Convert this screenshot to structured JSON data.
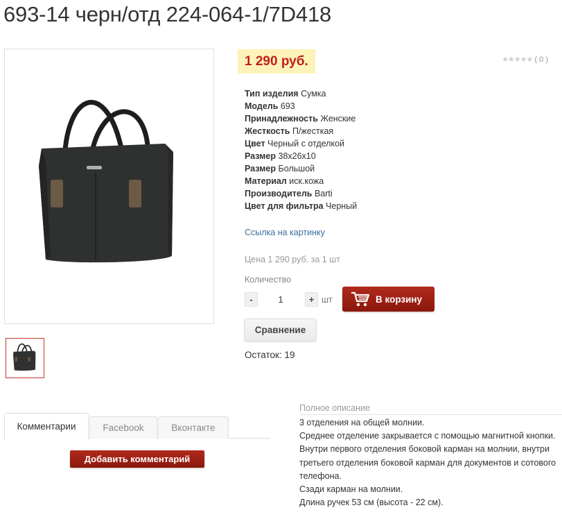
{
  "product": {
    "title": "693-14 черн/отд 224-064-1/7D418",
    "price": "1 290 руб.",
    "rating": {
      "stars": "★★★★★",
      "count": "( 0 )"
    },
    "properties": [
      {
        "key": "Тип изделия",
        "value": "Сумка"
      },
      {
        "key": "Модель",
        "value": "693"
      },
      {
        "key": "Принадлежность",
        "value": "Женские"
      },
      {
        "key": "Жесткость",
        "value": "П/жесткая"
      },
      {
        "key": "Цвет",
        "value": "Черный с отделкой"
      },
      {
        "key": "Размер",
        "value": "38х26х10"
      },
      {
        "key": "Размер",
        "value": "Большой"
      },
      {
        "key": "Материал",
        "value": "иск.кожа"
      },
      {
        "key": "Производитель",
        "value": "Barti"
      },
      {
        "key": "Цвет для фильтра",
        "value": "Черный"
      }
    ],
    "image_link": "Ссылка на картинку",
    "price_per_unit": "Цена 1 290 руб. за 1 шт",
    "quantity": {
      "label": "Количество",
      "minus": "-",
      "value": "1",
      "plus": "+",
      "unit": "шт"
    },
    "cart_button": "В корзину",
    "compare_button": "Сравнение",
    "stock": "Остаток: 19"
  },
  "tabs": [
    {
      "label": "Комментарии",
      "active": true
    },
    {
      "label": "Facebook",
      "active": false
    },
    {
      "label": "Вконтакте",
      "active": false
    }
  ],
  "add_comment_button": "Добавить комментарий",
  "description": {
    "heading": "Полное описание",
    "lines": [
      "3 отделения на общей молнии.",
      "Среднее отделение закрывается с помощью магнитной кнопки.",
      "Внутри первого отделения боковой карман на молнии, внутри третьего отделения боковой карман для документов и сотового телефона.",
      "Сзади карман на молнии.",
      "Длина ручек 53 см (высота - 22 см)."
    ]
  },
  "colors": {
    "accent_red": "#a4241a",
    "price_red": "#c0201c",
    "price_bg": "#fdf3b8",
    "link_blue": "#3a6f9e"
  },
  "icons": {
    "cart": "shopping-cart-icon",
    "rating": "star-icon"
  }
}
